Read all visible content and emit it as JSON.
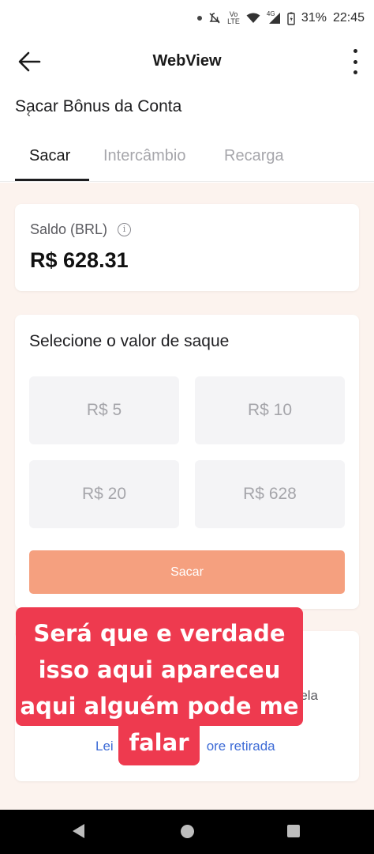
{
  "status_bar": {
    "volte_top": "Vo",
    "volte_bottom": "LTE",
    "network": "4G",
    "battery": "31%",
    "time": "22:45",
    "icons": [
      "dot-icon",
      "mute-icon",
      "volte-icon",
      "wifi-icon",
      "signal-icon",
      "battery-icon"
    ]
  },
  "app_bar": {
    "title": "WebView",
    "back_icon": "arrow-left-icon",
    "menu_icon": "more-vertical-icon"
  },
  "page": {
    "title": "Sacar Bônus da Conta",
    "mini_back": "‹"
  },
  "tabs": [
    {
      "label": "Sacar",
      "active": true
    },
    {
      "label": "Intercâmbio",
      "active": false
    },
    {
      "label": "Recarga",
      "active": false
    }
  ],
  "balance": {
    "label": "Saldo (BRL)",
    "info_icon": "i",
    "value": "R$ 628.31"
  },
  "withdraw": {
    "title": "Selecione o valor de saque",
    "amounts": [
      "R$ 5",
      "R$ 10",
      "R$ 20",
      "R$ 628"
    ],
    "submit_label": "Sacar"
  },
  "bottom": {
    "text_fragment": "ela",
    "link_start": "Lei",
    "link_end": "ore retirada"
  },
  "overlay": {
    "lines": [
      "Será que e verdade",
      "isso aqui apareceu",
      "aqui alguém pode me",
      "falar"
    ],
    "color": "#ee3a4f"
  },
  "colors": {
    "accent": "#f5a07f",
    "background": "#fcf3ee",
    "link": "#3d6bd6"
  }
}
